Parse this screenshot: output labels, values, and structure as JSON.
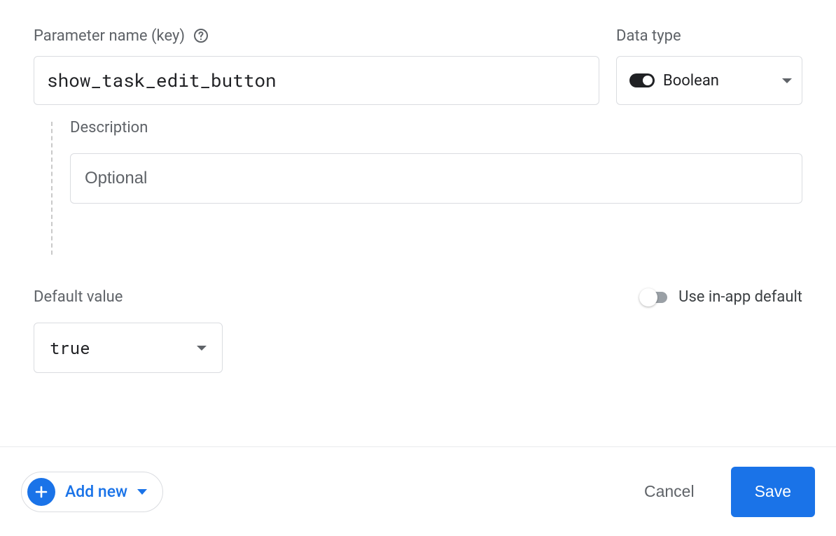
{
  "labels": {
    "parameter_name": "Parameter name (key)",
    "data_type": "Data type",
    "description": "Description",
    "default_value": "Default value",
    "use_in_app_default": "Use in-app default"
  },
  "form": {
    "parameter_name_value": "show_task_edit_button",
    "data_type_selected": "Boolean",
    "description_value": "",
    "description_placeholder": "Optional",
    "default_value_selected": "true",
    "use_in_app_default_on": false
  },
  "footer": {
    "add_new": "Add new",
    "cancel": "Cancel",
    "save": "Save"
  }
}
